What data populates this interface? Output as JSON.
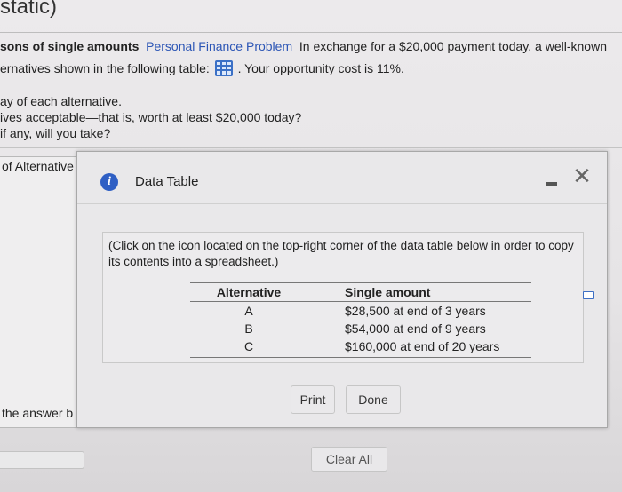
{
  "background": {
    "title": "static)",
    "line1_bold": "sons of single amounts",
    "line1_link": "Personal Finance Problem",
    "line1_rest": "In exchange for a $20,000 payment today, a well-known",
    "line2_before": "ernatives shown in the following table:",
    "line2_after": ". Your opportunity cost is 11%.",
    "q1": "ay of each alternative.",
    "q2": "ives acceptable—that is, worth at least $20,000 today?",
    "q3": "if any, will you take?",
    "section_label": "of Alternative",
    "answer_label": "the answer b",
    "clear_all": "Clear All"
  },
  "modal": {
    "title": "Data Table",
    "instructions": "(Click on the icon located on the top-right corner of the data table below in order to copy its contents into a spreadsheet.)",
    "table": {
      "headers": [
        "Alternative",
        "Single amount"
      ],
      "rows": [
        [
          "A",
          "$28,500 at end of 3 years"
        ],
        [
          "B",
          "$54,000 at end of 9 years"
        ],
        [
          "C",
          "$160,000 at end of 20 years"
        ]
      ]
    },
    "print_label": "Print",
    "done_label": "Done"
  },
  "colors": {
    "accent_blue": "#2f5fc4",
    "link_blue": "#2b55b5"
  },
  "icons": [
    "info-icon",
    "close-icon",
    "minimize-icon",
    "copy-icon",
    "spreadsheet-grid-icon"
  ]
}
